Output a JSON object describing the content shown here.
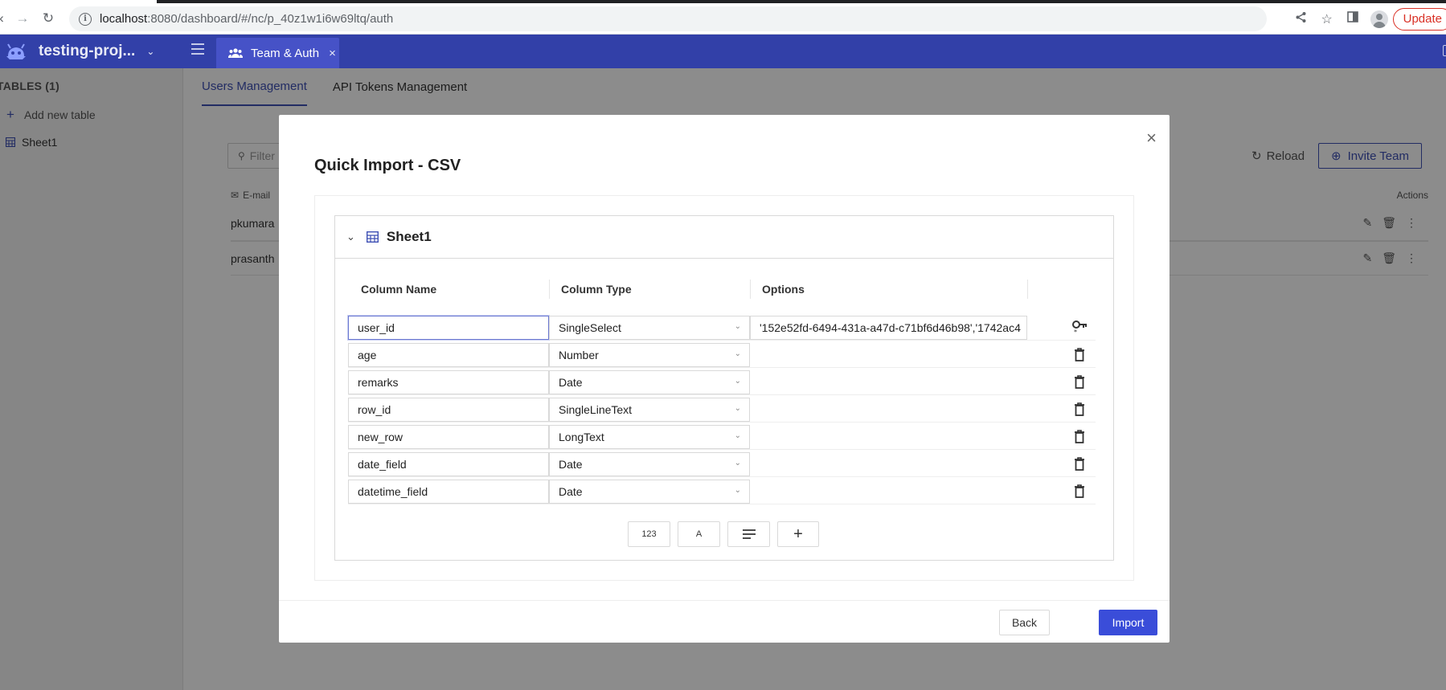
{
  "browser": {
    "url_host": "localhost",
    "url_rest": ":8080/dashboard/#/nc/p_40z1w1i6w69ltq/auth",
    "update_label": "Update"
  },
  "app": {
    "project_name": "testing-proj...",
    "tab_label": "Team & Auth",
    "tab_close": "×"
  },
  "sidebar": {
    "title": "TABLES (1)",
    "add_table": "Add new table",
    "items": [
      {
        "label": "Sheet1"
      }
    ]
  },
  "main": {
    "tabs": [
      {
        "label": "Users Management"
      },
      {
        "label": "API Tokens Management"
      }
    ],
    "filter_placeholder": "Filter",
    "reload_label": "Reload",
    "invite_label": "Invite Team",
    "email_header": "E-mail",
    "actions_header": "Actions",
    "rows": [
      {
        "email": "pkumara"
      },
      {
        "email": "prasanth"
      }
    ]
  },
  "modal": {
    "title": "Quick Import - CSV",
    "sheet_name": "Sheet1",
    "headers": {
      "name": "Column Name",
      "type": "Column Type",
      "options": "Options"
    },
    "fields": [
      {
        "name": "user_id",
        "type": "SingleSelect",
        "options": "'152e52fd-6494-431a-a47d-c71bf6d46b98','1742ac4"
      },
      {
        "name": "age",
        "type": "Number",
        "options": ""
      },
      {
        "name": "remarks",
        "type": "Date",
        "options": ""
      },
      {
        "name": "row_id",
        "type": "SingleLineText",
        "options": ""
      },
      {
        "name": "new_row",
        "type": "LongText",
        "options": ""
      },
      {
        "name": "date_field",
        "type": "Date",
        "options": ""
      },
      {
        "name": "datetime_field",
        "type": "Date",
        "options": ""
      }
    ],
    "add_buttons": [
      {
        "label": "123"
      },
      {
        "label": "A"
      },
      {
        "label": ""
      },
      {
        "label": "+"
      }
    ],
    "back_label": "Back",
    "import_label": "Import"
  },
  "icons": {
    "primary_key": "key-icon",
    "delete": "trash-icon"
  },
  "colors": {
    "brand": "#3240a8",
    "accent": "#3f51b5",
    "primary_button": "#3a4dd9"
  }
}
